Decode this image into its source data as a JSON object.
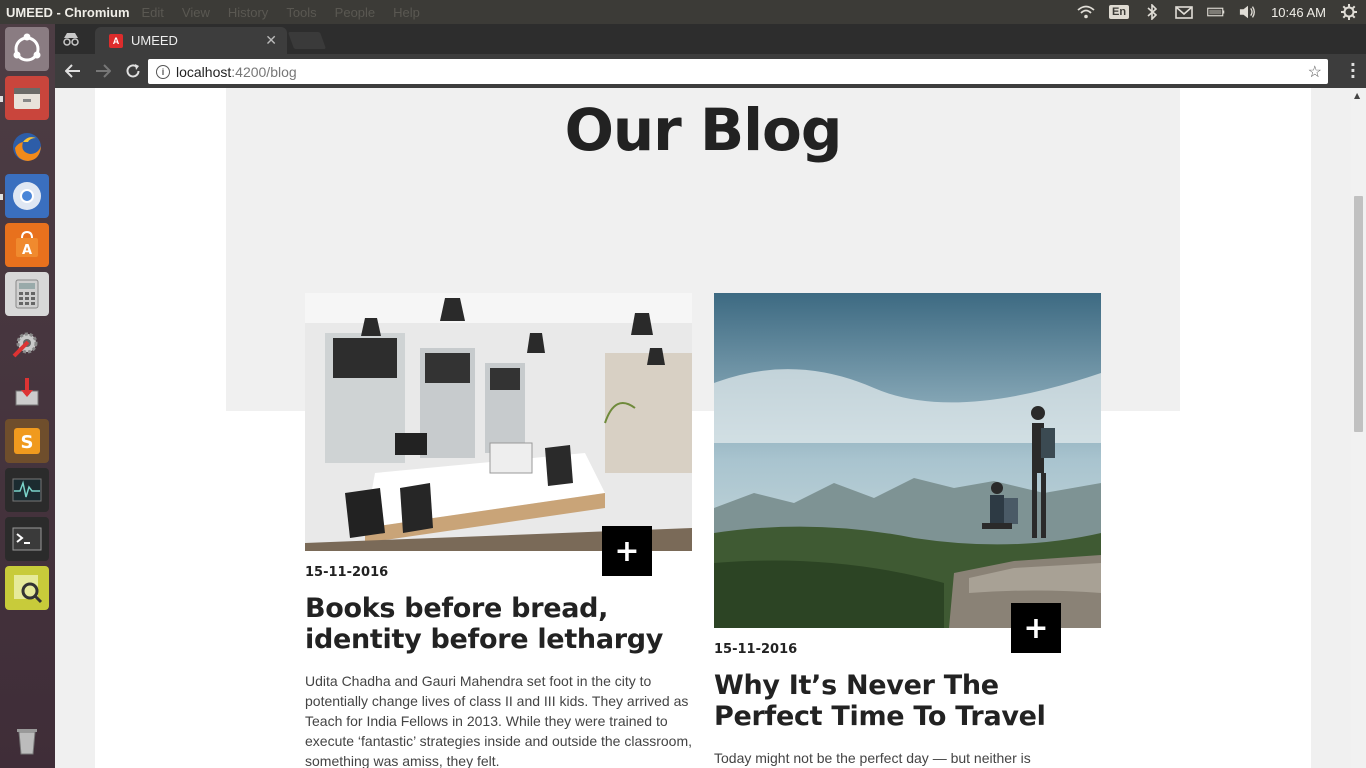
{
  "system": {
    "app_title": "UMEED - Chromium",
    "menus": [
      "Edit",
      "View",
      "History",
      "Tools",
      "People",
      "Help"
    ],
    "lang": "En",
    "clock": "10:46 AM"
  },
  "launcher": {
    "items": [
      "ubuntu-dash",
      "files",
      "firefox",
      "chromium",
      "software-center",
      "calculator",
      "system-settings",
      "installer",
      "sublime-text",
      "system-monitor",
      "terminal",
      "image-viewer",
      "trash"
    ]
  },
  "browser": {
    "tab_title": "UMEED",
    "tab_favicon": "A",
    "url_host": "localhost",
    "url_path": ":4200/blog"
  },
  "page": {
    "title": "Our Blog",
    "posts": [
      {
        "date": "15-11-2016",
        "title": "Books before bread, identity before lethargy",
        "excerpt": "Udita Chadha and Gauri Mahendra set foot in the city to potentially change lives of class II and III kids. They arrived as Teach for India Fellows in 2013. While they were trained to execute ‘fantastic’ strategies inside and outside the classroom, something was amiss, they felt.",
        "plus": "+"
      },
      {
        "date": "15-11-2016",
        "title": "Why It’s Never The Perfect Time To Travel",
        "excerpt": "Today might not be the perfect day — but neither is",
        "plus": "+"
      }
    ]
  }
}
